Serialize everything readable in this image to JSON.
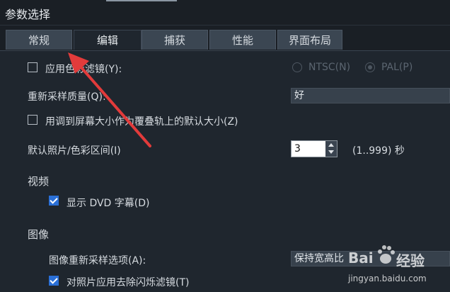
{
  "window": {
    "title": "参数选择"
  },
  "tabs": [
    {
      "label": "常规",
      "active": false
    },
    {
      "label": "编辑",
      "active": true
    },
    {
      "label": "捕获",
      "active": false
    },
    {
      "label": "性能",
      "active": false
    },
    {
      "label": "界面布局",
      "active": false
    }
  ],
  "settings": {
    "color_filter": {
      "label": "应用色彩滤镜(Y):",
      "checked": false
    },
    "ntsc": {
      "label": "NTSC(N)",
      "selected": false
    },
    "pal": {
      "label": "PAL(P)",
      "selected": true
    },
    "resample_quality": {
      "label": "重新采样质量(Q):",
      "value": "好"
    },
    "fit_overlay": {
      "label": "用调到屏幕大小作为覆叠轨上的默认大小(Z)",
      "checked": false
    },
    "default_duration": {
      "label": "默认照片/色彩区间(I)",
      "value": "3",
      "range": "(1..999) 秒"
    }
  },
  "video_section": {
    "heading": "视频",
    "show_dvd_subtitle": {
      "label": "显示 DVD 字幕(D)",
      "checked": true
    }
  },
  "image_section": {
    "heading": "图像",
    "resample_option": {
      "label": "图像重新采样选项(A):",
      "value": "保持宽高比"
    },
    "flicker_filter": {
      "label": "对照片应用去除闪烁滤镜(T)",
      "checked": true
    }
  },
  "watermark": {
    "brand": "Bai",
    "brand2": "经验",
    "url": "jingyan.baidu.com"
  },
  "colors": {
    "background": "#1f262e",
    "accent": "#2a6fd6",
    "annotation_arrow": "#e23b3b"
  }
}
